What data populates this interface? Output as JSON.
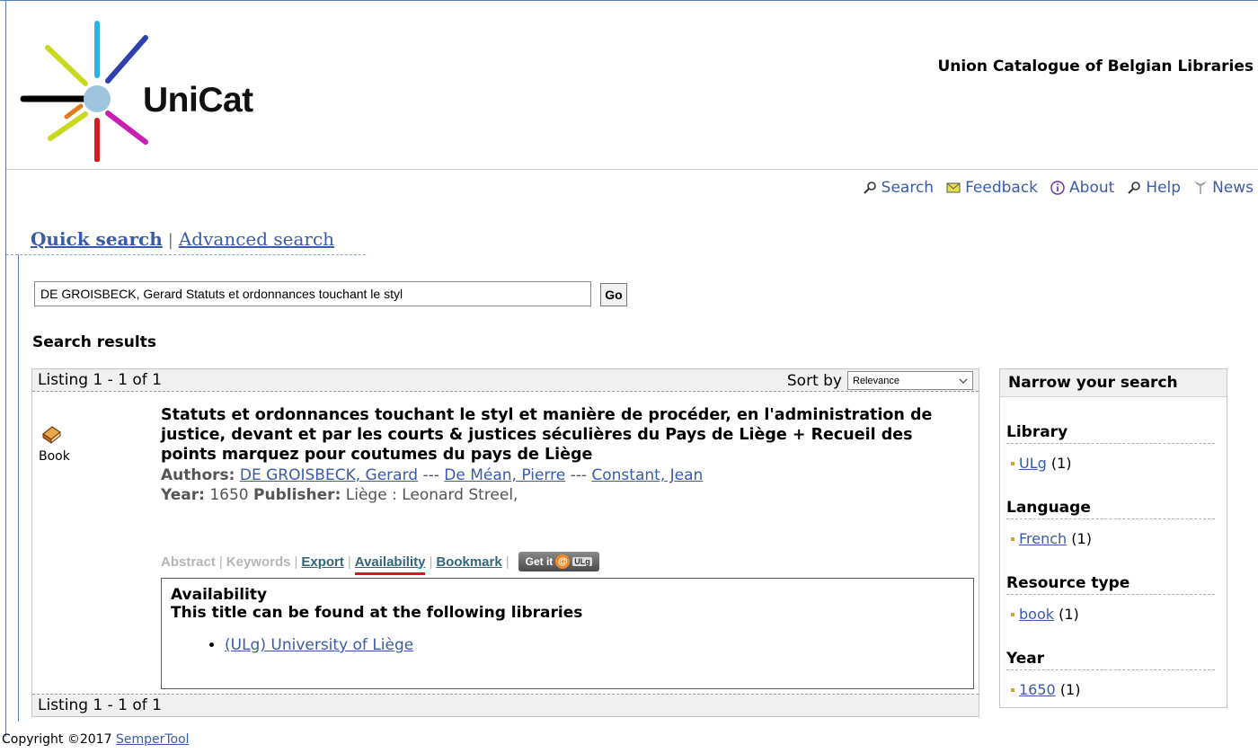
{
  "header": {
    "logo_text": "UniCat",
    "site_title": "Union Catalogue of Belgian Libraries"
  },
  "topnav": [
    {
      "label": "Search",
      "icon": "search-icon"
    },
    {
      "label": "Feedback",
      "icon": "envelope-icon"
    },
    {
      "label": "About",
      "icon": "info-icon"
    },
    {
      "label": "Help",
      "icon": "help-icon"
    },
    {
      "label": "News",
      "icon": "news-icon"
    }
  ],
  "tabs": {
    "quick": "Quick search",
    "separator": "|",
    "advanced": "Advanced search"
  },
  "search": {
    "value": "DE GROISBECK, Gerard Statuts et ordonnances touchant le styl",
    "go_label": "Go"
  },
  "results": {
    "heading": "Search results",
    "listing_text": "Listing 1 - 1 of 1",
    "sort_label": "Sort by",
    "sort_value": "Relevance"
  },
  "record": {
    "type_label": "Book",
    "title": "Statuts et ordonnances touchant le styl et manière de procéder, en l'administration de justice, devant et par les courts & justices séculières du Pays de Liège + Recueil des points marquez pour coutumes du pays de Liège",
    "authors_label": "Authors",
    "authors": [
      "DE GROISBECK, Gerard",
      "De Méan, Pierre",
      "Constant, Jean"
    ],
    "author_separator": "---",
    "year_label": "Year",
    "year": "1650",
    "publisher_label": "Publisher",
    "publisher": "Liège : Leonard Streel,",
    "actions": {
      "abstract": "Abstract",
      "keywords": "Keywords",
      "export": "Export",
      "availability": "Availability",
      "bookmark": "Bookmark",
      "pipe": "|",
      "getit_prefix": "Get it",
      "getit_at": "@",
      "getit_ulg": "ULg"
    },
    "availability": {
      "title": "Availability",
      "subtitle": "This title can be found at the following libraries",
      "libraries": [
        "(ULg) University of Liège"
      ]
    }
  },
  "narrow": {
    "heading": "Narrow your search",
    "facets": [
      {
        "title": "Library",
        "value": "ULg",
        "count": "(1)"
      },
      {
        "title": "Language",
        "value": "French",
        "count": "(1)"
      },
      {
        "title": "Resource type",
        "value": "book",
        "count": "(1)"
      },
      {
        "title": "Year",
        "value": "1650",
        "count": "(1)"
      }
    ]
  },
  "footer": {
    "copyright": "Copyright ©2017",
    "link": "SemperTool"
  },
  "colors": {
    "link": "#3a5ba8",
    "frame": "#5b7fb3",
    "active_underline": "#e8121f"
  }
}
